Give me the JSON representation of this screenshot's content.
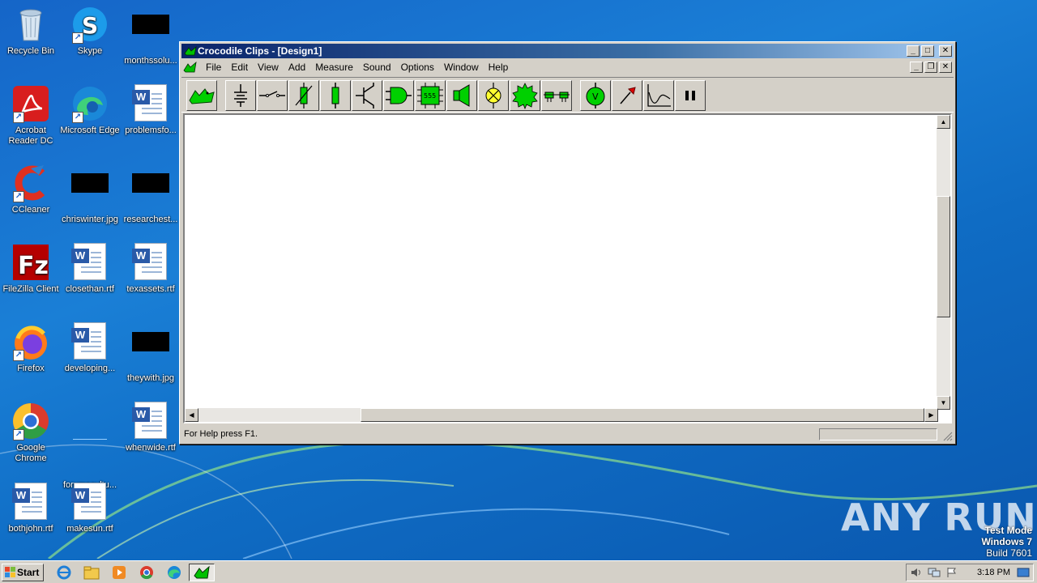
{
  "desktop": {
    "icons": [
      {
        "label": "Recycle Bin"
      },
      {
        "label": "Skype"
      },
      {
        "label": "monthssolu..."
      },
      {
        "label": "Acrobat Reader DC"
      },
      {
        "label": "Microsoft Edge"
      },
      {
        "label": "problemsfo..."
      },
      {
        "label": "CCleaner"
      },
      {
        "label": "chriswinter.jpg"
      },
      {
        "label": "researchest..."
      },
      {
        "label": "FileZilla Client"
      },
      {
        "label": "closethan.rtf"
      },
      {
        "label": "texassets.rtf"
      },
      {
        "label": "Firefox"
      },
      {
        "label": "developing..."
      },
      {
        "label": "theywith.jpg"
      },
      {
        "label": "Google Chrome"
      },
      {
        "label": "forumscultu..."
      },
      {
        "label": "whenwide.rtf"
      },
      {
        "label": "bothjohn.rtf"
      },
      {
        "label": "makesun.rtf"
      }
    ]
  },
  "window": {
    "title": "Crocodile Clips - [Design1]",
    "menu": [
      "File",
      "Edit",
      "View",
      "Add",
      "Measure",
      "Sound",
      "Options",
      "Window",
      "Help"
    ],
    "toolbar": [
      {
        "icon": "crocodile-logo-icon"
      },
      {
        "icon": "battery-icon"
      },
      {
        "icon": "switch-icon"
      },
      {
        "icon": "thermistor-icon"
      },
      {
        "icon": "resistor-icon"
      },
      {
        "icon": "transistor-icon"
      },
      {
        "icon": "logic-gate-icon"
      },
      {
        "icon": "chip-555-icon",
        "text": "555"
      },
      {
        "icon": "speaker-icon"
      },
      {
        "icon": "lamp-icon"
      },
      {
        "icon": "motor-gear-icon"
      },
      {
        "icon": "relay-icon"
      },
      {
        "icon": "voltmeter-icon",
        "text": "V"
      },
      {
        "icon": "probe-icon"
      },
      {
        "icon": "graph-icon"
      },
      {
        "icon": "pause-icon"
      }
    ],
    "status_text": "For Help press F1."
  },
  "watermark": "ANY RUN",
  "test_mode": {
    "line1": "Test Mode",
    "line2": "Windows 7",
    "line3": "Build 7601"
  },
  "taskbar": {
    "start_label": "Start",
    "clock": "3:18 PM"
  },
  "colors": {
    "accent_green": "#00e000",
    "title_blue": "#0a246a",
    "chrome": "#d4d0c8"
  }
}
